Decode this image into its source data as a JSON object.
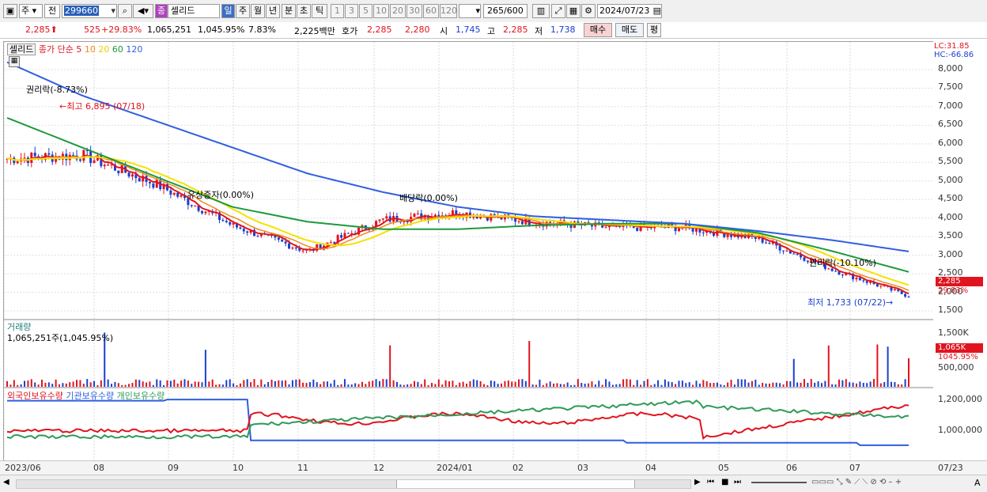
{
  "toolbar": {
    "market": "주",
    "scope": "전",
    "code": "299660",
    "stock_type": "종",
    "stock_name": "셀리드",
    "periods": [
      "일",
      "주",
      "월",
      "년",
      "분",
      "초",
      "틱"
    ],
    "minutes": [
      "1",
      "3",
      "5",
      "10",
      "20",
      "30",
      "60",
      "120"
    ],
    "count": "265",
    "count_total": "/600",
    "date": "2024/07/23"
  },
  "quote": {
    "price": "2,285",
    "change": "525",
    "change_pct": "+29.83%",
    "volume": "1,065,251",
    "volume_ratio": "1,045.95%",
    "turnover": "7.83%",
    "amount": "2,225백만",
    "bid_label": "호가",
    "ask_price": "2,285",
    "bid_price": "2,280",
    "open_label": "시",
    "open": "1,745",
    "high_label": "고",
    "high": "2,285",
    "low_label": "저",
    "low": "1,738",
    "buy_label": "매수",
    "sell_label": "매도",
    "avg_label": "평"
  },
  "legend": {
    "name": "셀리드",
    "series": "종가 단순",
    "ma5": "5",
    "ma10": "10",
    "ma20": "20",
    "ma60": "60",
    "ma120": "120"
  },
  "colors": {
    "up": "#e0141e",
    "down": "#1b3fd0",
    "ma5": "#e0141e",
    "ma10": "#f08a1c",
    "ma20": "#f5e100",
    "ma60": "#1d9a3c",
    "ma120": "#2f5fe0",
    "inst": "#2f9a58"
  },
  "right_axis": {
    "lc": "LC:31.85",
    "hc": "HC:-66.86",
    "price_ticks": [
      "8,000",
      "7,500",
      "7,000",
      "6,500",
      "6,000",
      "5,500",
      "5,000",
      "4,500",
      "4,000",
      "3,500",
      "3,000",
      "2,500",
      "2,000",
      "1,500"
    ],
    "price_tag": "2,285",
    "price_tag_pct": "29.83%",
    "vol_ticks": [
      "1,500K",
      "1,000K",
      "500,000"
    ],
    "vol_tag": "1,065K",
    "vol_tag_pct": "1045.95%",
    "hold_ticks": [
      "1,200,000",
      "1,000,000"
    ]
  },
  "annotations": {
    "rights1": "권리락(-8.73%)",
    "high": "최고 6,895 (07/18)",
    "capinc": "유상증자(0.00%)",
    "dividend": "배당락(0.00%)",
    "rights2": "권리락(-10.10%)",
    "low": "최저 1,733 (07/22)"
  },
  "volume_panel": {
    "title": "거래량",
    "value": "1,065,251주(1,045.95%)"
  },
  "holding_panel": {
    "foreign": "외국인보유수량",
    "institution": "기관보유수량",
    "individual": "개인보유수량"
  },
  "dates": [
    "2023/06",
    "08",
    "09",
    "10",
    "11",
    "12",
    "2024/01",
    "02",
    "03",
    "04",
    "05",
    "06",
    "07",
    "07/23"
  ],
  "chart_data": {
    "type": "line",
    "title": "셀리드",
    "x": [
      "2023/06",
      "08",
      "09",
      "10",
      "11",
      "12",
      "2024/01",
      "02",
      "03",
      "04",
      "05",
      "06",
      "07"
    ],
    "series": [
      {
        "name": "종가",
        "values": [
          5600,
          5700,
          4900,
          3800,
          3100,
          3950,
          4150,
          3900,
          3750,
          3750,
          3450,
          2600,
          1900
        ]
      },
      {
        "name": "60",
        "values": [
          6700,
          5900,
          5100,
          4300,
          3900,
          3700,
          3700,
          3800,
          3850,
          3850,
          3600,
          3100,
          2550
        ]
      },
      {
        "name": "120",
        "values": [
          8200,
          7300,
          6600,
          5900,
          5200,
          4700,
          4300,
          4050,
          3950,
          3850,
          3650,
          3400,
          3100
        ]
      }
    ],
    "ylim": [
      1500,
      8000
    ]
  }
}
